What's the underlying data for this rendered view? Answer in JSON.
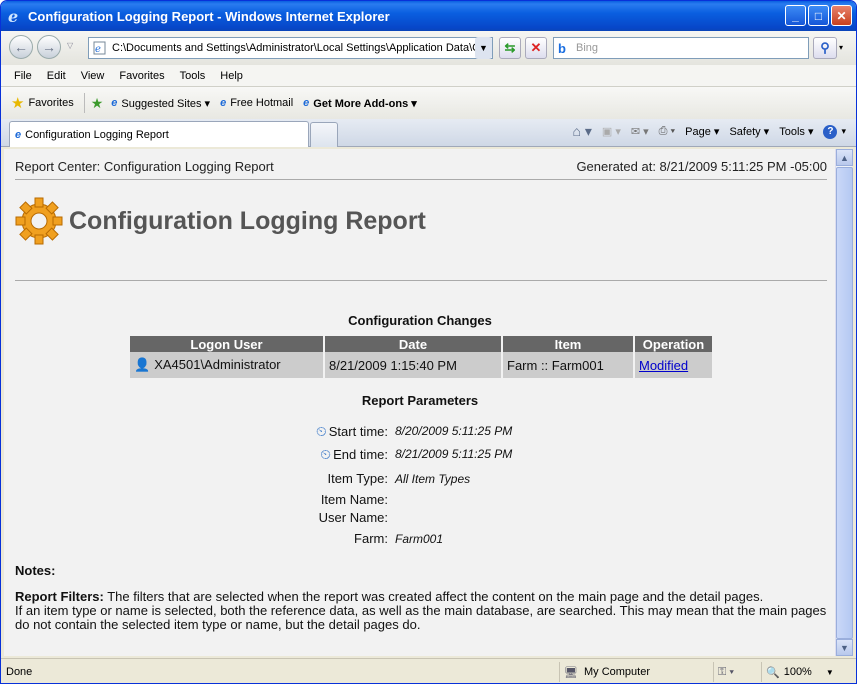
{
  "window": {
    "title": "Configuration Logging Report - Windows Internet Explorer",
    "address": "C:\\Documents and Settings\\Administrator\\Local Settings\\Application Data\\C",
    "search_placeholder": "Bing"
  },
  "menu": [
    "File",
    "Edit",
    "View",
    "Favorites",
    "Tools",
    "Help"
  ],
  "favorites": {
    "favorites_label": "Favorites",
    "items": [
      "Suggested Sites ▾",
      "Free Hotmail",
      "Get More Add-ons ▾"
    ]
  },
  "tab": {
    "label": "Configuration Logging Report"
  },
  "commands": {
    "page": "Page ▾",
    "safety": "Safety ▾",
    "tools": "Tools ▾"
  },
  "report": {
    "header_left": "Report Center: Configuration Logging Report",
    "header_right": "Generated at: 8/21/2009 5:11:25 PM -05:00",
    "title": "Configuration Logging Report",
    "changes_title": "Configuration Changes",
    "columns": [
      "Logon User",
      "Date",
      "Item",
      "Operation"
    ],
    "rows": [
      {
        "user": "XA4501\\Administrator",
        "date": "8/21/2009 1:15:40 PM",
        "item": "Farm :: Farm001",
        "operation": "Modified"
      }
    ],
    "params_title": "Report Parameters",
    "params": {
      "start_label": "Start time:",
      "start_value": "8/20/2009 5:11:25 PM",
      "end_label": "End time:",
      "end_value": "8/21/2009 5:11:25 PM",
      "type_label": "Item Type:",
      "type_value": "All Item Types",
      "name_label": "Item Name:",
      "user_label": "User Name:",
      "farm_label": "Farm:",
      "farm_value": "Farm001"
    },
    "notes_title": "Notes:",
    "filters_label": "Report Filters:",
    "filters_text": " The filters that are selected when the report was created affect the content on the main page and the detail pages.",
    "filters_text2": "If an item type or name is selected, both the reference data, as well as the main database, are searched. This may mean that the main pages do not contain the selected item type or name, but the detail pages do."
  },
  "status": {
    "left": "Done",
    "zone": "My Computer",
    "zoom": "100%"
  }
}
